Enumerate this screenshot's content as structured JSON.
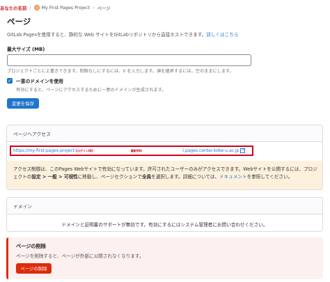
{
  "breadcrumb": {
    "user": "あなたの名前",
    "project": "My First Pages Project",
    "current": "ページ"
  },
  "page": {
    "title": "ページ",
    "description": "GitLab Pagesを使用すると、静的な Web サイトをGitLabリポジトリから直接ホストできます。",
    "learn_more": "詳しくはこちら"
  },
  "max_size": {
    "label": "最大サイズ (MB)",
    "value": "",
    "help": "プロジェクトごとに上書きできます。制限なしにするには、0 を入力します。値を継承するには、空のままにします。"
  },
  "unique_domain": {
    "checked": "✓",
    "label": "一意のドメインを使用",
    "help": "有効にすると、ページにアクセスするために一意のドメインが生成されます。"
  },
  "save_button": "変更を保存",
  "access": {
    "heading": "ページへアクセス",
    "url_start": "https://my-first-pages-project-",
    "url_red_1": "[ログインID]",
    "url_mid": "-",
    "url_red_2": "最新学科",
    "url_end": ").pages.center.kobe-u.ac.jp",
    "external_icon": "external-link-icon",
    "warning_part1": "アクセス制御は、このPages Webサイトで有効になっています。許可されたユーザーのみがアクセスできます。Webサイトを公開するには、プロジェクトの",
    "warning_bold1": "設定 > 一般 > 可視性",
    "warning_part2": "に移動し、ページセクションで",
    "warning_bold2": "全員",
    "warning_part3": "を選択します。詳細については、",
    "warning_link": "ドキュメント",
    "warning_part4": "を参照してください。"
  },
  "domains": {
    "heading": "ドメイン",
    "message": "ドメインと証明書のサポートが無効です。有効にするにはシステム管理者にお問い合わせください。"
  },
  "delete": {
    "title": "ページの削除",
    "description": "ページを削除すると、ページが外部に公開されなくなります。",
    "button": "ページの削除"
  }
}
